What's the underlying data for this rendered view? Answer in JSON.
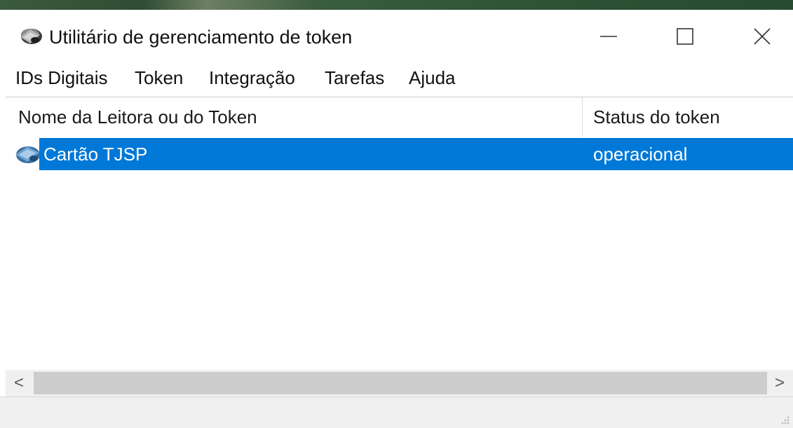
{
  "window": {
    "title": "Utilitário de gerenciamento de token",
    "icon": "token-reader-icon"
  },
  "window_controls": {
    "minimize_icon": "minimize-icon",
    "maximize_icon": "maximize-icon",
    "close_icon": "close-icon"
  },
  "menu": {
    "items": [
      {
        "label": "IDs Digitais"
      },
      {
        "label": "Token"
      },
      {
        "label": "Integração"
      },
      {
        "label": "Tarefas"
      },
      {
        "label": "Ajuda"
      }
    ]
  },
  "list": {
    "columns": [
      {
        "label": "Nome da Leitora ou do Token"
      },
      {
        "label": "Status do token"
      }
    ],
    "rows": [
      {
        "name": "Cartão TJSP",
        "status": "operacional",
        "selected": true,
        "icon": "token-card-icon"
      }
    ]
  },
  "scrollbar": {
    "left_arrow": "<",
    "right_arrow": ">"
  },
  "colors": {
    "selection": "#0078d7",
    "selection_text": "#ffffff",
    "chrome_gray": "#f0f0f0"
  }
}
